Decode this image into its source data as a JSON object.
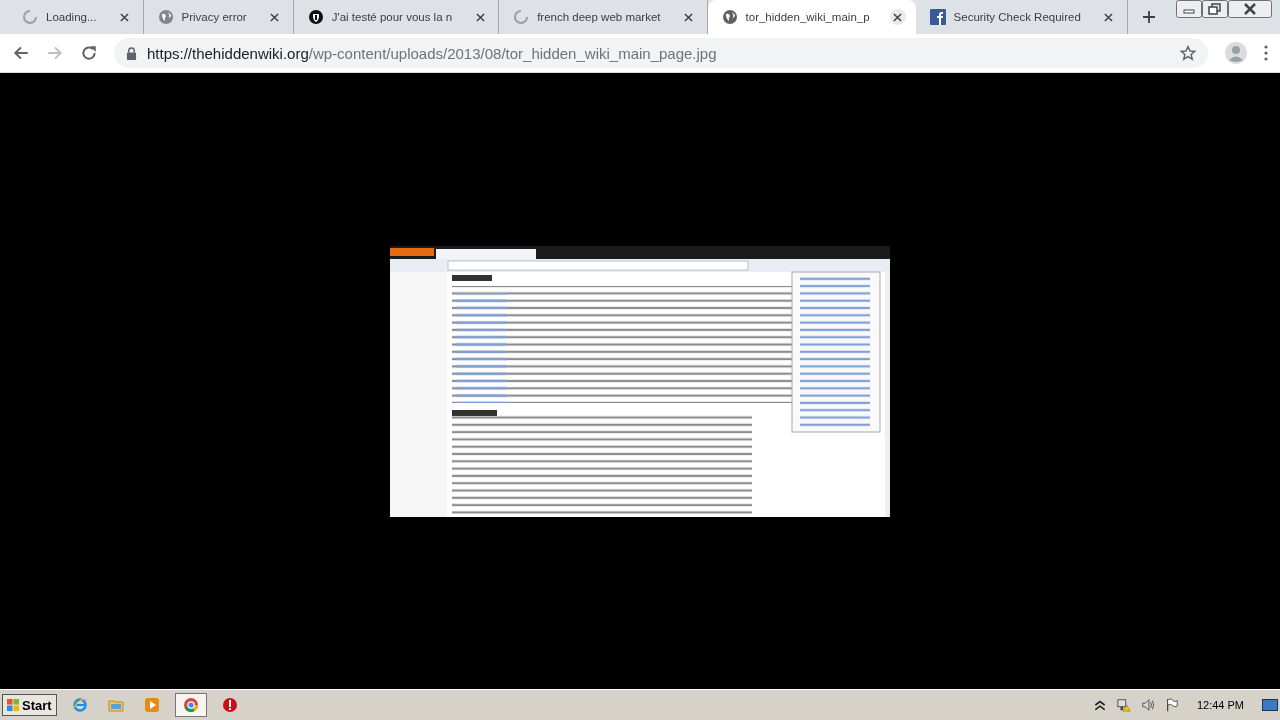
{
  "tabs": [
    {
      "kind": "spinner",
      "title": "Loading...",
      "selected": false
    },
    {
      "kind": "globe",
      "title": "Privacy error",
      "selected": false
    },
    {
      "kind": "shield",
      "title": "J'ai testé pour vous la n",
      "selected": false
    },
    {
      "kind": "spinner",
      "title": "french deep web market",
      "selected": false
    },
    {
      "kind": "globe",
      "title": "tor_hidden_wiki_main_p",
      "selected": true
    },
    {
      "kind": "facebook",
      "title": "Security Check Required",
      "selected": false
    }
  ],
  "address": {
    "host": "https://thehiddenwiki.org",
    "path": "/wp-content/uploads/2013/08/tor_hidden_wiki_main_page.jpg"
  },
  "taskbar": {
    "start": "Start",
    "apps": [
      {
        "kind": "ie",
        "selected": false
      },
      {
        "kind": "folder",
        "selected": false
      },
      {
        "kind": "media",
        "selected": false
      },
      {
        "kind": "chrome",
        "selected": true
      },
      {
        "kind": "opera",
        "selected": false
      }
    ],
    "time": "12:44 PM"
  }
}
